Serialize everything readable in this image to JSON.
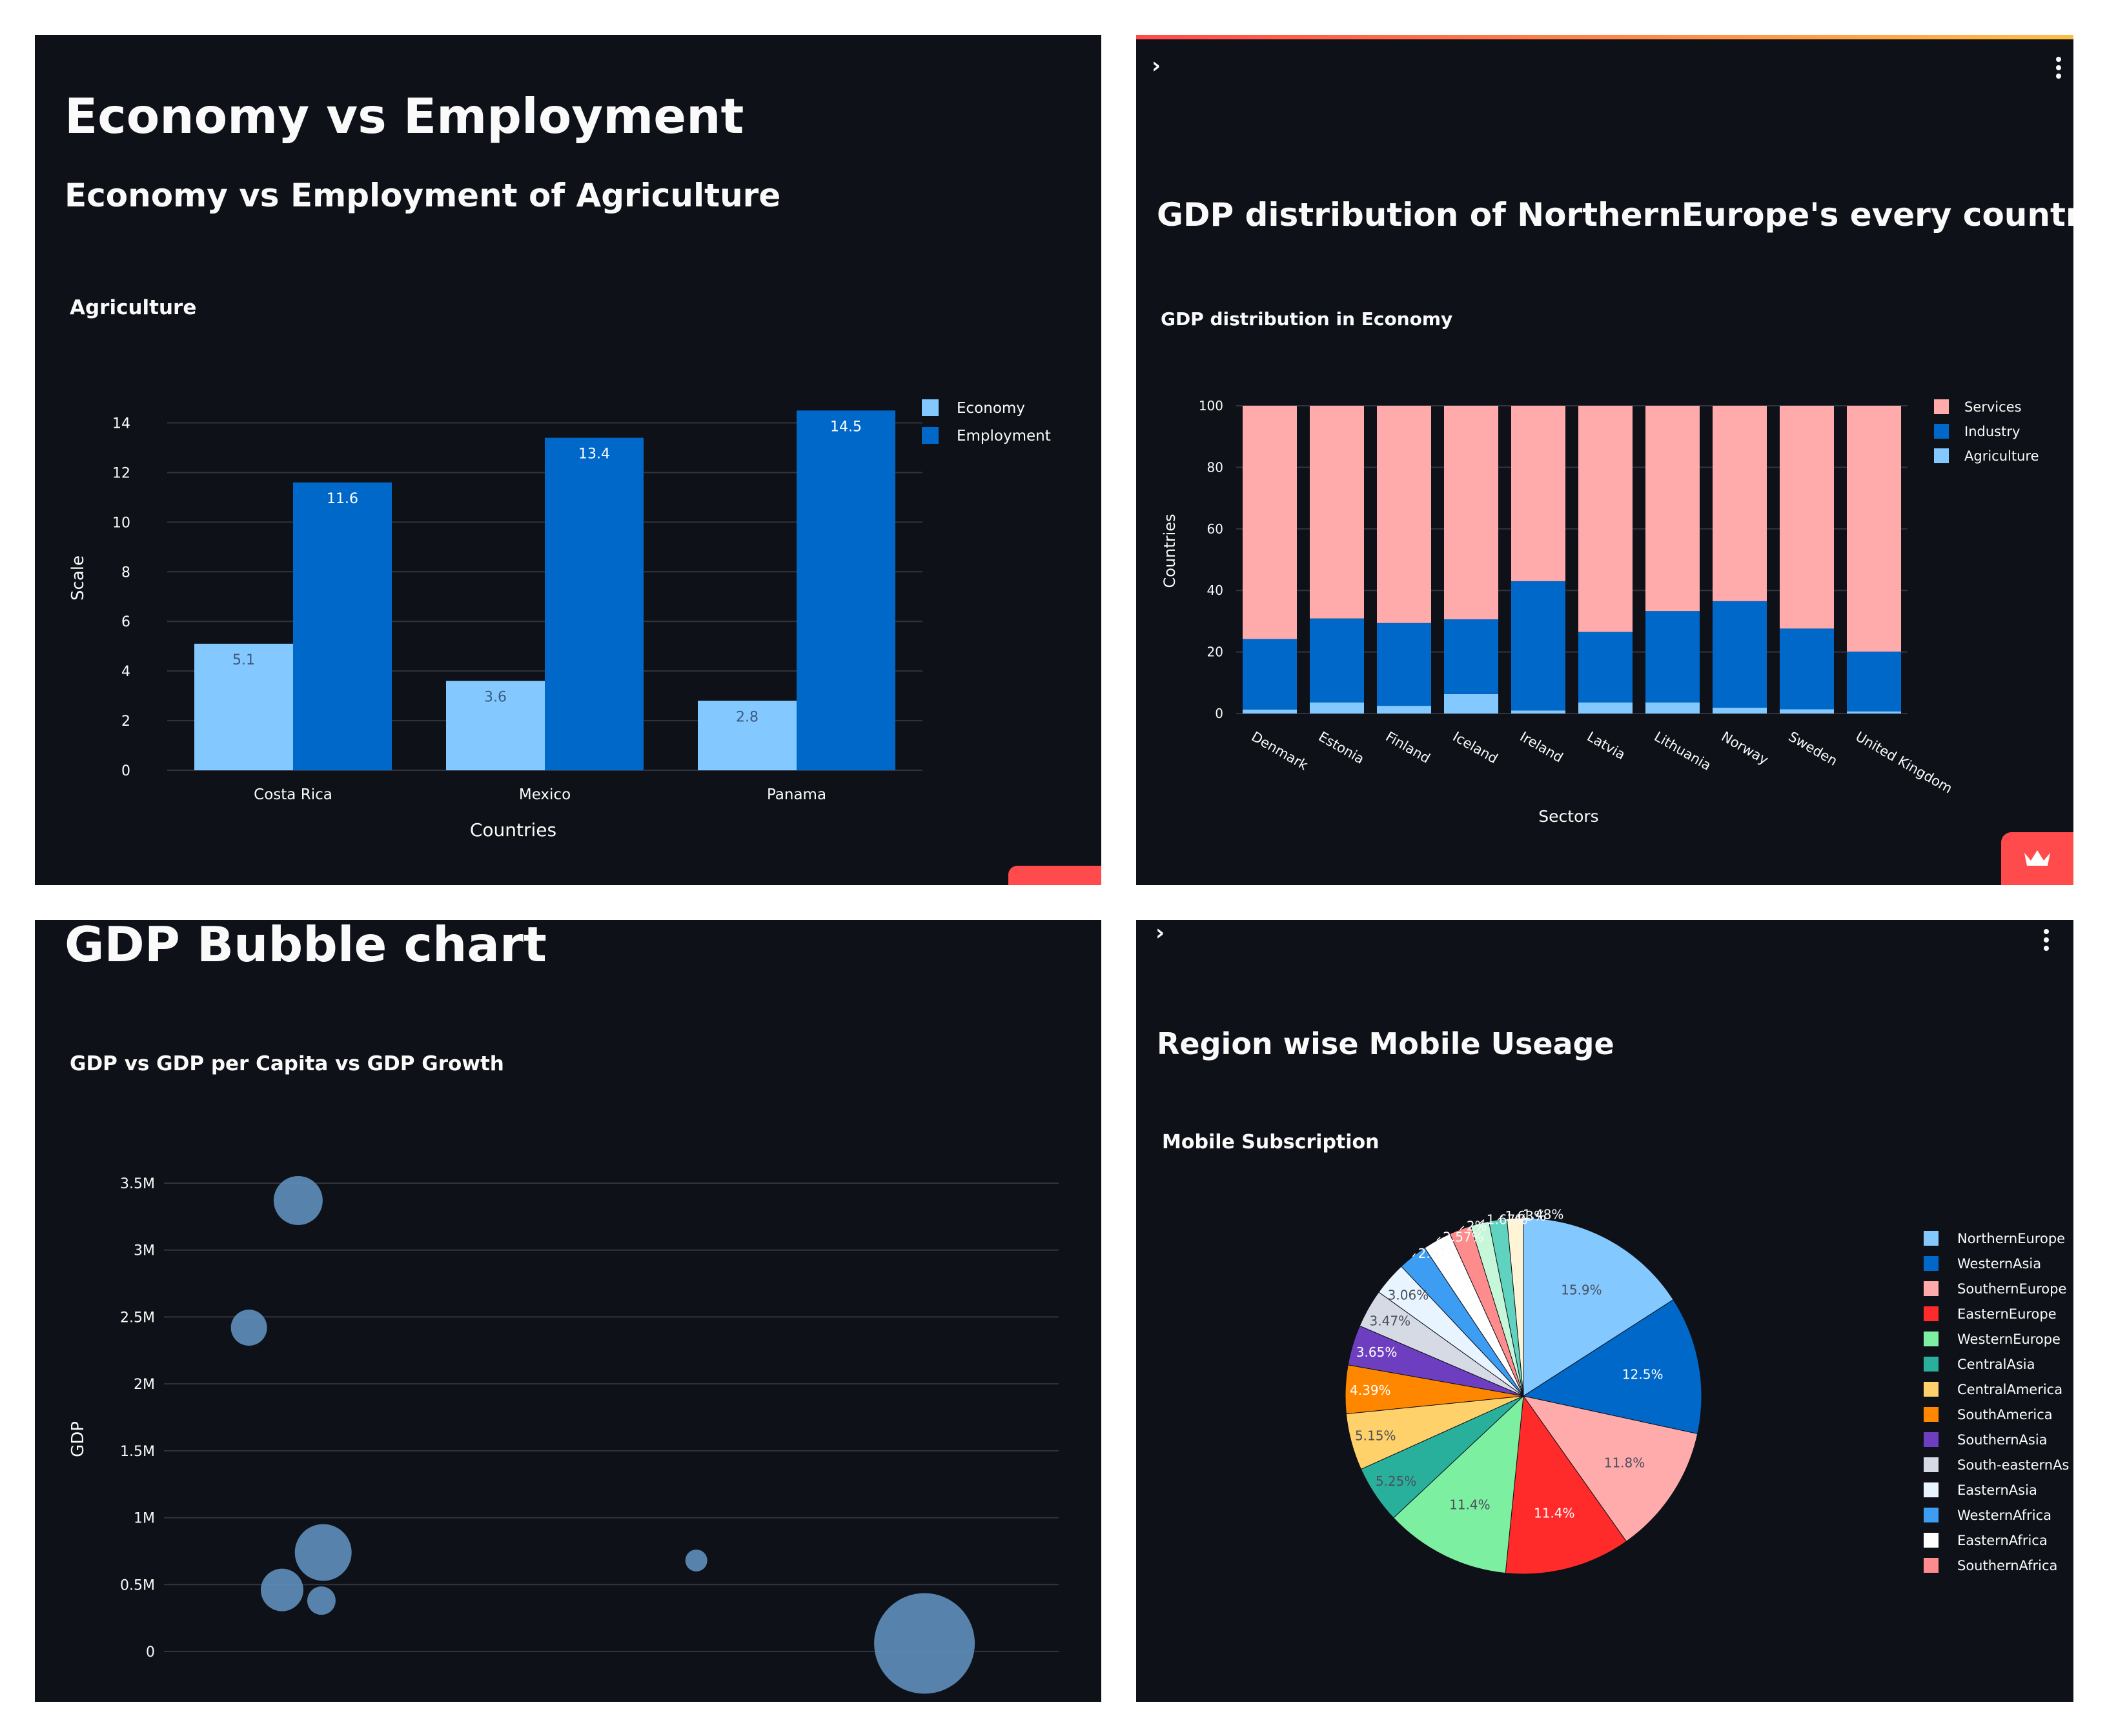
{
  "panel1": {
    "page_title": "Economy vs Employment",
    "section_title": "Economy vs Employment of Agriculture",
    "chart_title": "Agriculture"
  },
  "panel2": {
    "section_title": "GDP distribution of NorthernEurope's every country",
    "chart_title": "GDP distribution in Economy"
  },
  "panel3": {
    "page_title": "GDP Bubble chart",
    "chart_title": "GDP vs GDP per Capita vs GDP Growth"
  },
  "panel4": {
    "section_title": "Region wise Mobile Useage",
    "chart_title": "Mobile Subscription"
  },
  "icons": {
    "sidebar_expand": "chevron-right-icon",
    "main_menu": "kebab-menu-icon",
    "streamlit_badge": "crown-icon"
  },
  "colors": {
    "background": "#0e1117",
    "text": "#fafafa",
    "grid": "#31333f",
    "accent": "#ff4b4b",
    "light_blue": "#83c9ff",
    "blue": "#0068c9",
    "pink": "#ffabab",
    "bubble": "#5e8fbd"
  },
  "chart_data": [
    {
      "type": "bar",
      "title": "Agriculture",
      "xlabel": "Countries",
      "ylabel": "Scale",
      "categories": [
        "Costa Rica",
        "Mexico",
        "Panama"
      ],
      "series": [
        {
          "name": "Economy",
          "values": [
            5.1,
            3.6,
            2.8
          ],
          "color": "#83c9ff"
        },
        {
          "name": "Employment",
          "values": [
            11.6,
            13.4,
            14.5
          ],
          "color": "#0068c9"
        }
      ],
      "yticks": [
        "0",
        "2",
        "4",
        "6",
        "8",
        "10",
        "12",
        "14"
      ],
      "ylim": [
        0,
        15.6
      ],
      "grid": true,
      "legend": "top-right"
    },
    {
      "type": "bar",
      "stacked": true,
      "title": "GDP distribution in Economy",
      "xlabel": "Sectors",
      "ylabel": "Countries",
      "categories": [
        "Denmark",
        "Estonia",
        "Finland",
        "Iceland",
        "Ireland",
        "Latvia",
        "Lithuania",
        "Norway",
        "Sweden",
        "United Kingdom"
      ],
      "series": [
        {
          "name": "Agriculture",
          "values": [
            1.3,
            3.6,
            2.5,
            6.3,
            1.0,
            3.6,
            3.6,
            1.9,
            1.4,
            0.7
          ],
          "color": "#83c9ff"
        },
        {
          "name": "Industry",
          "values": [
            22.9,
            27.3,
            26.9,
            24.3,
            42.0,
            22.9,
            29.7,
            34.6,
            26.2,
            19.4
          ],
          "color": "#0068c9"
        },
        {
          "name": "Services",
          "values": [
            75.8,
            69.1,
            70.6,
            69.4,
            57.0,
            73.5,
            66.7,
            63.5,
            72.4,
            79.9
          ],
          "color": "#ffabab"
        }
      ],
      "legend_order": [
        "Services",
        "Industry",
        "Agriculture"
      ],
      "yticks": [
        "0",
        "20",
        "40",
        "60",
        "80",
        "100"
      ],
      "ylim": [
        0,
        100
      ],
      "grid": true,
      "legend": "top-right"
    },
    {
      "type": "scatter",
      "bubble": true,
      "title": "GDP vs GDP per Capita vs GDP Growth",
      "ylabel": "GDP",
      "yticks": [
        "0",
        "0.5M",
        "1M",
        "1.5M",
        "2M",
        "2.5M",
        "3M",
        "3.5M"
      ],
      "ylim": [
        0,
        3.5
      ],
      "xlim": [
        0,
        100
      ],
      "points": [
        {
          "x": 15,
          "y": 3.37,
          "size": 3.8
        },
        {
          "x": 9.5,
          "y": 2.42,
          "size": 2.8
        },
        {
          "x": 17.8,
          "y": 0.74,
          "size": 4.4
        },
        {
          "x": 13.2,
          "y": 0.46,
          "size": 3.3
        },
        {
          "x": 17.6,
          "y": 0.38,
          "size": 2.2
        },
        {
          "x": 59.5,
          "y": 0.68,
          "size": 1.7
        },
        {
          "x": 85,
          "y": 0.06,
          "size": 7.8
        }
      ],
      "grid": true
    },
    {
      "type": "pie",
      "title": "Mobile Subscription",
      "slices": [
        {
          "label": "NorthernEurope",
          "value": 15.9,
          "text": "15.9%",
          "color": "#83c9ff"
        },
        {
          "label": "WesternAsia",
          "value": 12.5,
          "text": "12.5%",
          "color": "#0068c9"
        },
        {
          "label": "SouthernEurope",
          "value": 11.8,
          "text": "11.8%",
          "color": "#ffabab"
        },
        {
          "label": "EasternEurope",
          "value": 11.4,
          "text": "11.4%",
          "color": "#ff2b2b"
        },
        {
          "label": "WesternEurope",
          "value": 11.4,
          "text": "11.4%",
          "color": "#7defa1"
        },
        {
          "label": "CentralAsia",
          "value": 5.25,
          "text": "5.25%",
          "color": "#29b09d"
        },
        {
          "label": "CentralAmerica",
          "value": 5.15,
          "text": "5.15%",
          "color": "#ffd16a"
        },
        {
          "label": "SouthAmerica",
          "value": 4.39,
          "text": "4.39%",
          "color": "#ff8700"
        },
        {
          "label": "SouthernAsia",
          "value": 3.65,
          "text": "3.65%",
          "color": "#6d3fc0"
        },
        {
          "label": "South-easternAs",
          "value": 3.47,
          "text": "3.47%",
          "color": "#d5dae5"
        },
        {
          "label": "EasternAsia",
          "value": 3.06,
          "text": "3.06%",
          "color": "#e8f4ff"
        },
        {
          "label": "WesternAfrica",
          "value": 2.67,
          "text": "2.67%",
          "color": "#3d9df3"
        },
        {
          "label": "EasternAfrica",
          "value": 2.57,
          "text": "2.57%",
          "color": "#ffffff"
        },
        {
          "label": "SouthernAfrica",
          "value": 2.0,
          "text": "2%",
          "color": "#ff8c8c"
        },
        {
          "label": "",
          "value": 1.67,
          "text": "1.67%",
          "color": "#c6f7d9"
        },
        {
          "label": "",
          "value": 1.63,
          "text": "1.63%",
          "color": "#5fd3bf"
        },
        {
          "label": "",
          "value": 1.48,
          "text": "1.48%",
          "color": "#fff4d6"
        }
      ],
      "legend": "right"
    }
  ]
}
